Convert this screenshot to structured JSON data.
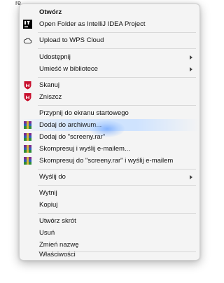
{
  "desktop": {
    "partial_label": "re"
  },
  "menu": {
    "items": [
      {
        "label": "Otwórz"
      },
      {
        "label": "Open Folder as IntelliJ IDEA Project",
        "icon": "intellij-icon"
      },
      {
        "label": "Upload to WPS Cloud",
        "icon": "cloud-icon"
      },
      {
        "label": "Udostępnij",
        "submenu": true
      },
      {
        "label": "Umieść w bibliotece",
        "submenu": true
      },
      {
        "label": "Skanuj",
        "icon": "mcafee-shield-icon"
      },
      {
        "label": "Zniszcz",
        "icon": "mcafee-shield-icon"
      },
      {
        "label": "Przypnij do ekranu startowego"
      },
      {
        "label": "Dodaj do archiwum...",
        "icon": "winrar-icon",
        "highlighted": true
      },
      {
        "label": "Dodaj do \"screeny.rar\"",
        "icon": "winrar-icon"
      },
      {
        "label": "Skompresuj i wyślij e-mailem...",
        "icon": "winrar-icon"
      },
      {
        "label": "Skompresuj do \"screeny.rar\" i wyślij e-mailem",
        "icon": "winrar-icon"
      },
      {
        "label": "Wyślij do",
        "submenu": true
      },
      {
        "label": "Wytnij"
      },
      {
        "label": "Kopiuj"
      },
      {
        "label": "Utwórz skrót"
      },
      {
        "label": "Usuń"
      },
      {
        "label": "Zmień nazwę"
      },
      {
        "label": "Właściwości"
      }
    ]
  },
  "colors": {
    "menu_background": "#f4f4f4",
    "highlight": "#cde2ff",
    "mcafee_red": "#c8102e",
    "winrar_purple": "#7b2c8f"
  }
}
